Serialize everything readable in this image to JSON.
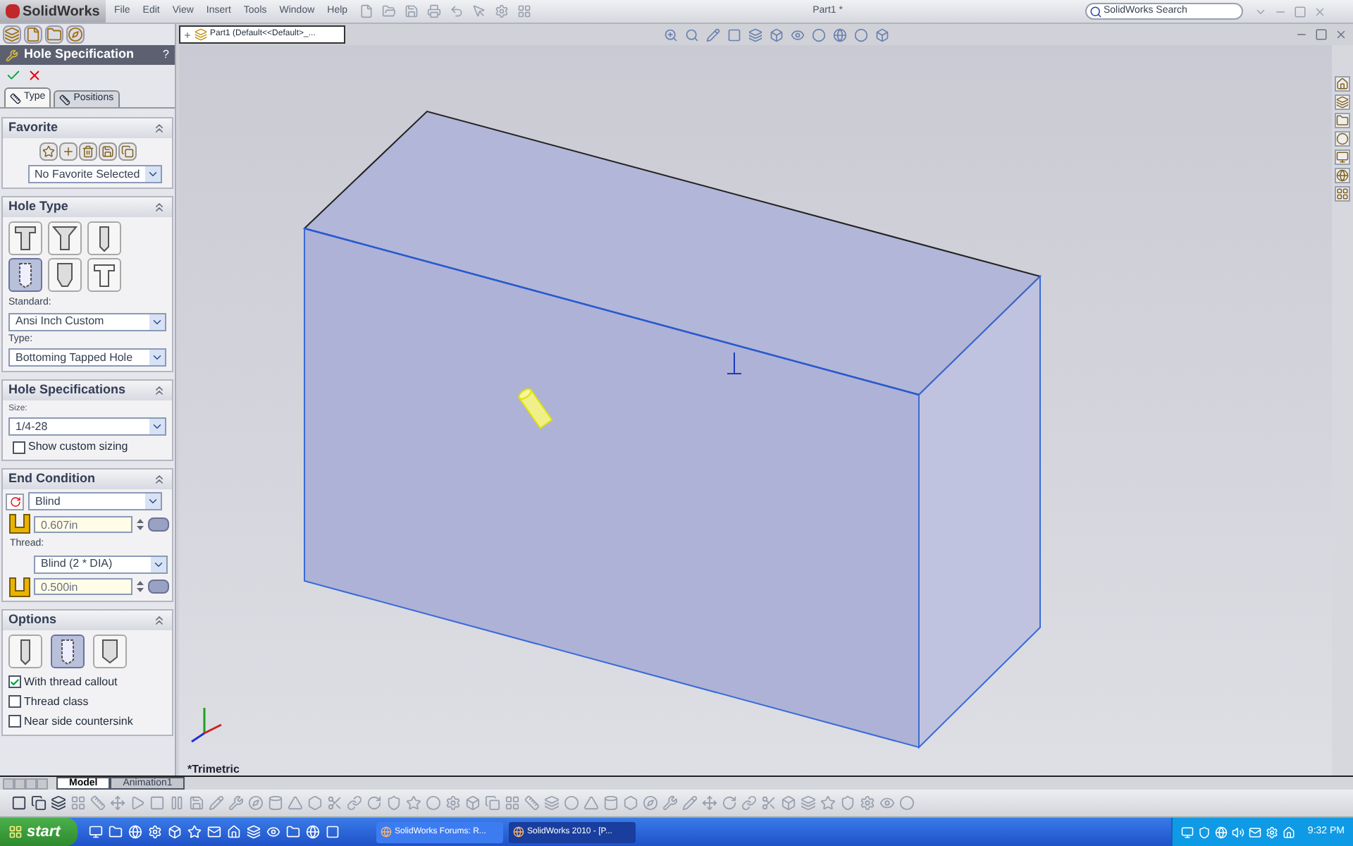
{
  "title_bar": {
    "logo": "SolidWorks",
    "menus": [
      "File",
      "Edit",
      "View",
      "Insert",
      "Tools",
      "Window",
      "Help"
    ],
    "document_title": "Part1 *",
    "search": {
      "placeholder": "SolidWorks Search"
    }
  },
  "tree_flyout": {
    "label": "Part1  (Default<<Default>_..."
  },
  "property_manager": {
    "title": "Hole Specification",
    "help": "?",
    "tabs": [
      {
        "label": "Type",
        "selected": true
      },
      {
        "label": "Positions",
        "selected": false
      }
    ],
    "favorite": {
      "header": "Favorite",
      "value": "No Favorite Selected"
    },
    "hole_type": {
      "header": "Hole Type",
      "types": [
        {
          "kind": "counterbore",
          "selected": false
        },
        {
          "kind": "countersink",
          "selected": false
        },
        {
          "kind": "hole",
          "selected": false
        },
        {
          "kind": "tap",
          "selected": true
        },
        {
          "kind": "pipe-tap",
          "selected": false
        },
        {
          "kind": "legacy",
          "selected": false
        }
      ],
      "standard_label": "Standard:",
      "standard": "Ansi Inch Custom",
      "type_label": "Type:",
      "type": "Bottoming Tapped Hole"
    },
    "hole_specifications": {
      "header": "Hole Specifications",
      "size_label": "Size:",
      "size": "1/4-28",
      "custom_sizing": {
        "label": "Show custom sizing",
        "checked": false
      }
    },
    "end_condition": {
      "header": "End Condition",
      "condition": "Blind",
      "depth": "0.607in",
      "thread_label": "Thread:",
      "thread": "Blind (2 * DIA)",
      "thread_depth": "0.500in"
    },
    "options": {
      "header": "Options",
      "styles": [
        {
          "kind": "tap-drill",
          "selected": false
        },
        {
          "kind": "cosmetic-thread",
          "selected": true
        },
        {
          "kind": "remove-thread",
          "selected": false
        }
      ],
      "checkboxes": [
        {
          "label": "With thread callout",
          "checked": true
        },
        {
          "label": "Thread class",
          "checked": false
        },
        {
          "label": "Near side countersink",
          "checked": false
        }
      ]
    }
  },
  "viewport": {
    "orientation": "*Trimetric"
  },
  "bottom_tabs": [
    {
      "label": "Model",
      "selected": true
    },
    {
      "label": "Animation1",
      "selected": false
    }
  ],
  "taskbar": {
    "start": "start",
    "tasks": [
      {
        "label": "SolidWorks Forums: R...",
        "selected": false
      },
      {
        "label": "SolidWorks 2010 - [P...",
        "selected": true
      }
    ],
    "clock": "9:32 PM"
  }
}
